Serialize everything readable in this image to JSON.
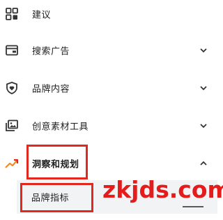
{
  "menu": {
    "items": [
      {
        "label": "建议",
        "icon": "grid-icon"
      },
      {
        "label": "搜索广告",
        "icon": "card-icon",
        "chevron": "down"
      },
      {
        "label": "品牌内容",
        "icon": "shield-icon",
        "chevron": "down"
      },
      {
        "label": "创意素材工具",
        "icon": "media-icon",
        "chevron": "down"
      },
      {
        "label": "洞察和规划",
        "icon": "trend-icon",
        "chevron": "up"
      }
    ],
    "sub_items": [
      {
        "label": "品牌指标"
      }
    ]
  },
  "watermark": "zkjds.com",
  "colors": {
    "highlight": "#e0281e",
    "accent_orange": "#f08c1e",
    "text": "#1f1f1f",
    "selected_bg": "#f2f3f5"
  }
}
